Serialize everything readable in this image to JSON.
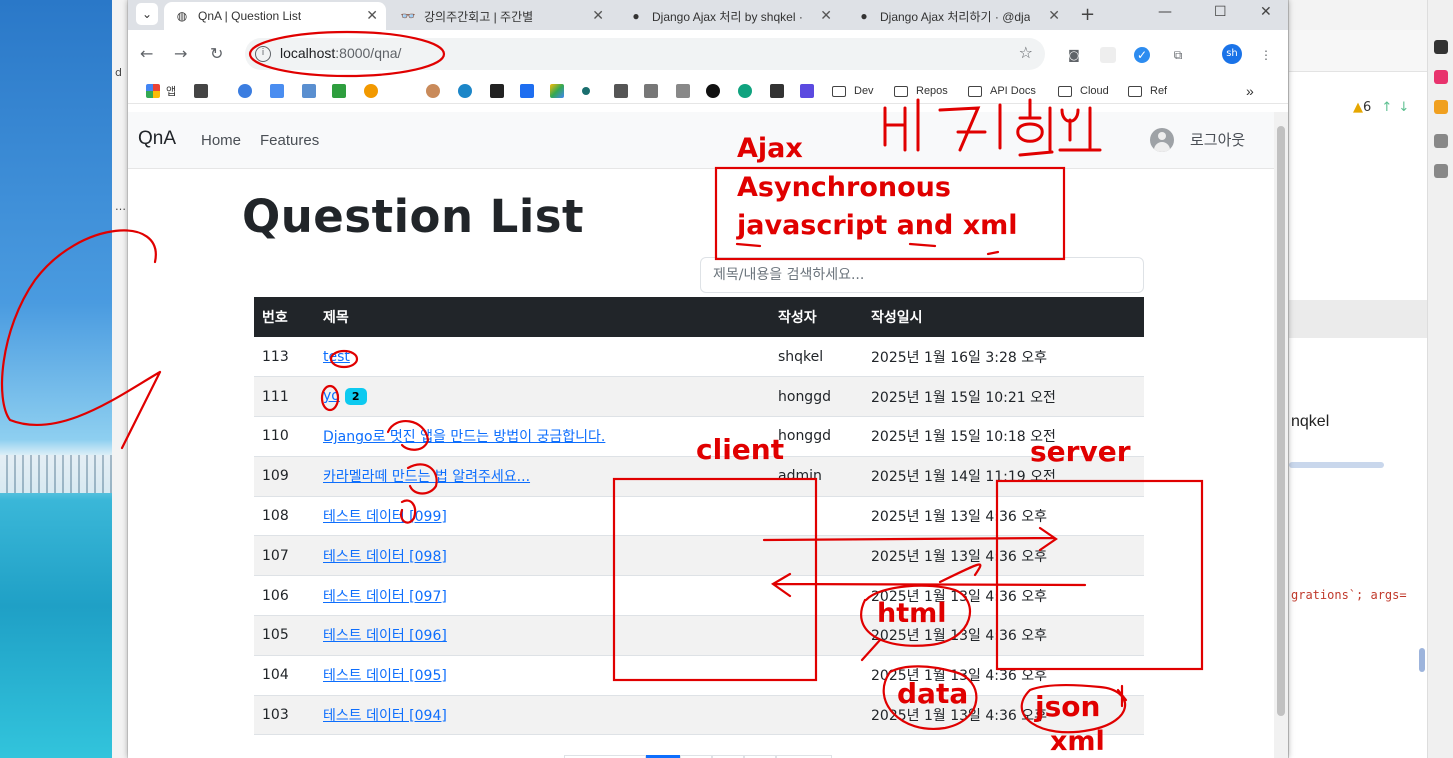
{
  "browser": {
    "tabs": [
      {
        "label": "QnA | Question List",
        "icon": "globe-icon",
        "active": true
      },
      {
        "label": "강의주간회고 | 주간별",
        "icon": "glasses-icon",
        "active": false
      },
      {
        "label": "Django Ajax 처리 by shqkel ·",
        "icon": "github-icon",
        "active": false
      },
      {
        "label": "Django Ajax 처리하기 · @dja",
        "icon": "github-icon",
        "active": false
      }
    ],
    "new_tab": "+",
    "url_host": "localhost",
    "url_path": ":8000/qna/",
    "profile_initials": "sh",
    "bookmarks": [
      "앱",
      "Dev",
      "Repos",
      "API Docs",
      "Cloud",
      "Ref"
    ],
    "bookmarks_more": "»"
  },
  "page": {
    "brand": "QnA",
    "nav": [
      "Home",
      "Features"
    ],
    "logout": "로그아웃",
    "title": "Question List",
    "search_placeholder": "제목/내용을 검색하세요..."
  },
  "table": {
    "headers": [
      "번호",
      "제목",
      "작성자",
      "작성일시"
    ],
    "rows": [
      {
        "no": "113",
        "title": "test",
        "badge": "",
        "author": "shqkel",
        "date": "2025년 1월 16일 3:28 오후"
      },
      {
        "no": "111",
        "title": "yo",
        "badge": "2",
        "author": "honggd",
        "date": "2025년 1월 15일 10:21 오전"
      },
      {
        "no": "110",
        "title": "Django로 멋진 앱을 만드는 방법이 궁금합니다.",
        "badge": "",
        "author": "honggd",
        "date": "2025년 1월 15일 10:18 오전"
      },
      {
        "no": "109",
        "title": "카라멜라떼 만드는 법 알려주세요...",
        "badge": "",
        "author": "admin",
        "date": "2025년 1월 14일 11:19 오전"
      },
      {
        "no": "108",
        "title": "테스트 데이터 [099]",
        "badge": "",
        "author": "",
        "date": "2025년 1월 13일 4:36 오후"
      },
      {
        "no": "107",
        "title": "테스트 데이터 [098]",
        "badge": "",
        "author": "",
        "date": "2025년 1월 13일 4:36 오후"
      },
      {
        "no": "106",
        "title": "테스트 데이터 [097]",
        "badge": "",
        "author": "",
        "date": "2025년 1월 13일 4:36 오후"
      },
      {
        "no": "105",
        "title": "테스트 데이터 [096]",
        "badge": "",
        "author": "",
        "date": "2025년 1월 13일 4:36 오후"
      },
      {
        "no": "104",
        "title": "테스트 데이터 [095]",
        "badge": "",
        "author": "",
        "date": "2025년 1월 13일 4:36 오후"
      },
      {
        "no": "103",
        "title": "테스트 데이터 [094]",
        "badge": "",
        "author": "",
        "date": "2025년 1월 13일 4:36 오후"
      }
    ]
  },
  "ide": {
    "warnings": "6",
    "text_line": "nqkel",
    "code_line": "grations`; args="
  },
  "annotations": {
    "korean": "비동기 통신",
    "ajax": "Ajax",
    "line1": "Asynchronous",
    "line2": "javascript and xml",
    "client": "client",
    "server": "server",
    "html": "html",
    "data": "data",
    "json": "json",
    "xml": "xml"
  },
  "colors": {
    "annotation": "#e00000",
    "link": "#0d6efd",
    "table_header": "#212529",
    "badge": "#0dcaf0"
  }
}
